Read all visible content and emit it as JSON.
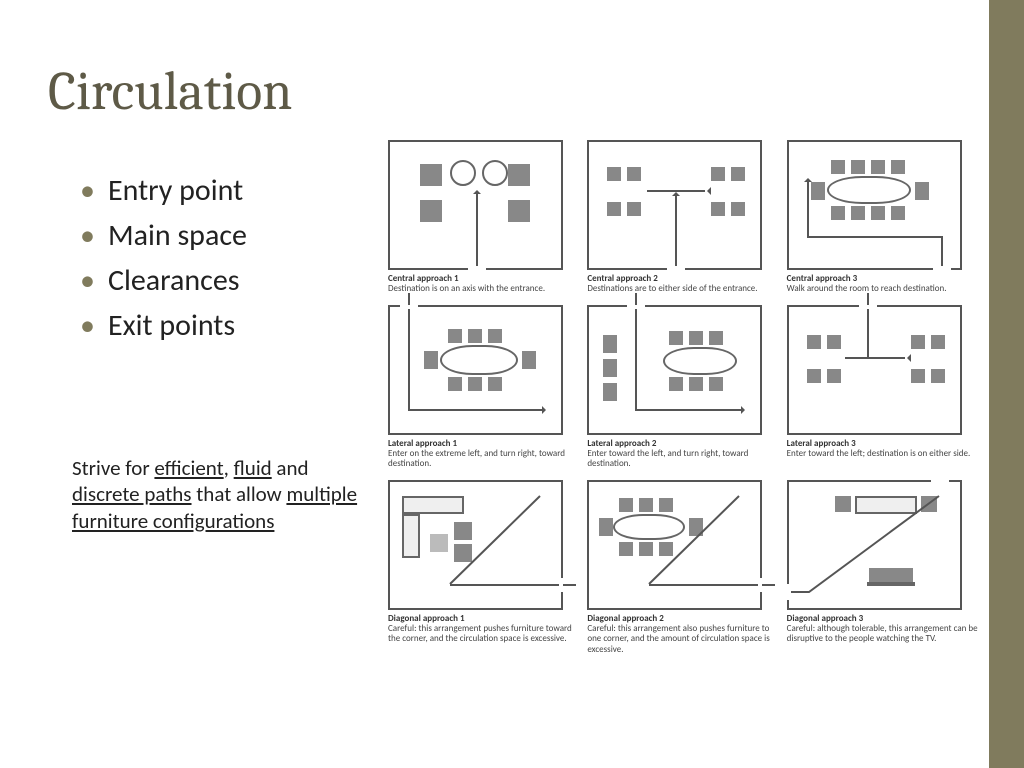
{
  "title": "Circulation",
  "bullets": [
    "Entry point",
    "Main space",
    "Clearances",
    "Exit points"
  ],
  "strive": {
    "t1": "Strive for ",
    "u1": "efficient",
    "t2": ", ",
    "u2": "fluid",
    "t3": " and ",
    "u3": "discrete paths",
    "t4": " that allow ",
    "u4": "multiple furniture configurations"
  },
  "diagrams": [
    {
      "title": "Central approach 1",
      "desc": "Destination is on an axis with the entrance."
    },
    {
      "title": "Central approach 2",
      "desc": "Destinations are to either side of the entrance."
    },
    {
      "title": "Central approach 3",
      "desc": "Walk around the room to reach destination."
    },
    {
      "title": "Lateral approach 1",
      "desc": "Enter on the extreme left, and turn right, toward destination."
    },
    {
      "title": "Lateral approach 2",
      "desc": "Enter toward the left, and turn right, toward destination."
    },
    {
      "title": "Lateral approach 3",
      "desc": "Enter toward the left; destination is on either side."
    },
    {
      "title": "Diagonal approach 1",
      "desc": "Careful: this arrangement pushes furniture toward the corner, and the circulation space is excessive."
    },
    {
      "title": "Diagonal approach 2",
      "desc": "Careful: this arrangement also pushes furniture to one corner, and the amount of circulation space is excessive."
    },
    {
      "title": "Diagonal approach 3",
      "desc": "Careful: although tolerable, this arrangement can be disruptive to the people watching the TV."
    }
  ]
}
